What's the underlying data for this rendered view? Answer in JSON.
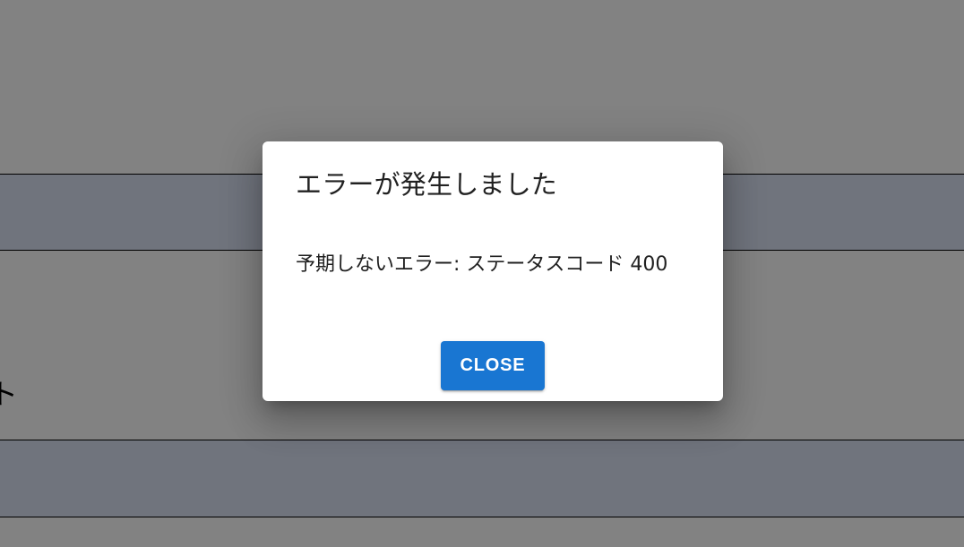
{
  "background": {
    "heading_fragment": "ト"
  },
  "dialog": {
    "title": "エラーが発生しました",
    "message": "予期しないエラー: ステータスコード 400",
    "close_label": "CLOSE"
  },
  "colors": {
    "button": "#1976d2",
    "band": "#dce3f5",
    "scrim": "rgba(0,0,0,0.49)"
  }
}
